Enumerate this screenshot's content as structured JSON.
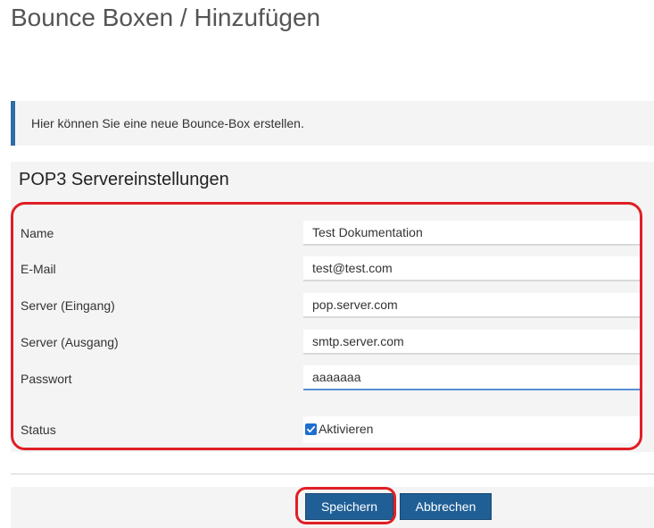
{
  "page": {
    "title": "Bounce Boxen / Hinzufügen"
  },
  "info": {
    "text": "Hier können Sie eine neue Bounce-Box erstellen."
  },
  "section": {
    "title": "POP3 Servereinstellungen"
  },
  "form": {
    "fields": [
      {
        "label": "Name",
        "value": "Test Dokumentation"
      },
      {
        "label": "E-Mail",
        "value": "test@test.com"
      },
      {
        "label": "Server (Eingang)",
        "value": "pop.server.com"
      },
      {
        "label": "Server (Ausgang)",
        "value": "smtp.server.com"
      },
      {
        "label": "Passwort",
        "value": "aaaaaaa"
      }
    ],
    "status": {
      "label": "Status",
      "checkbox_label": "Aktivieren",
      "checked": true
    }
  },
  "buttons": {
    "save_label": "Speichern",
    "cancel_label": "Abbrechen"
  },
  "colors": {
    "primary_button": "#1f5f96",
    "info_accent": "#2e6da4",
    "annotation_red": "#e01f26",
    "checkbox": "#1e6fd0"
  }
}
